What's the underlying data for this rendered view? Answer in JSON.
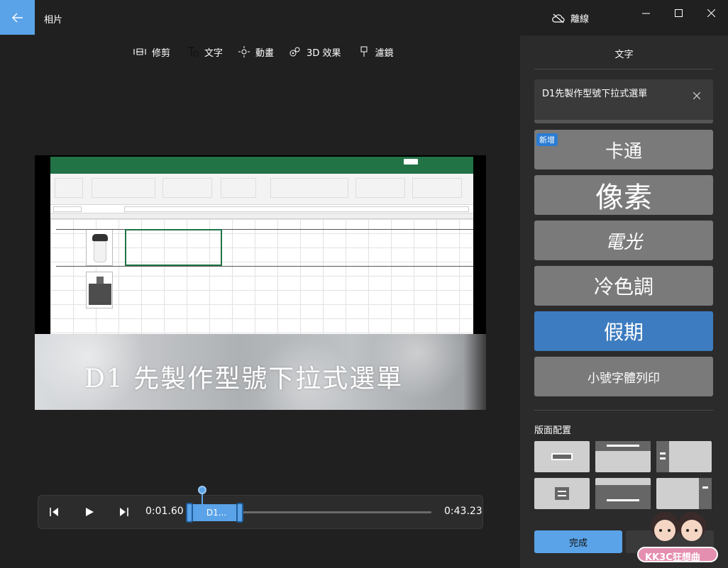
{
  "app": {
    "title": "相片",
    "offline_label": "離線"
  },
  "toolbar": {
    "items": [
      {
        "label": "修剪",
        "icon": "trim-icon",
        "active": false
      },
      {
        "label": "文字",
        "icon": "text-icon",
        "active": true
      },
      {
        "label": "動畫",
        "icon": "motion-icon",
        "active": false
      },
      {
        "label": "3D 效果",
        "icon": "3d-effects-icon",
        "active": false
      },
      {
        "label": "濾鏡",
        "icon": "filter-icon",
        "active": false
      }
    ]
  },
  "preview": {
    "overlay_text": "D1 先製作型號下拉式選單"
  },
  "playback": {
    "current_time": "0:01.60",
    "total_time": "0:43.23",
    "clip_label": "D1..."
  },
  "panel": {
    "title": "文字",
    "text_value": "D1先製作型號下拉式選單",
    "styles": [
      {
        "label": "卡通",
        "badge": "新增",
        "selected": false
      },
      {
        "label": "像素",
        "selected": false
      },
      {
        "label": "電光",
        "selected": false
      },
      {
        "label": "冷色調",
        "selected": false
      },
      {
        "label": "假期",
        "selected": true
      },
      {
        "label": "小號字體列印",
        "selected": false
      }
    ],
    "layout_label": "版面配置",
    "done_label": "完成"
  },
  "watermark": {
    "text": "KK3C狂想曲"
  },
  "colors": {
    "accent": "#5aa3e8",
    "selected_style": "#3d7cc0",
    "excel_green": "#217346",
    "panel_bg": "#2b2b2b",
    "app_bg": "#202020"
  }
}
